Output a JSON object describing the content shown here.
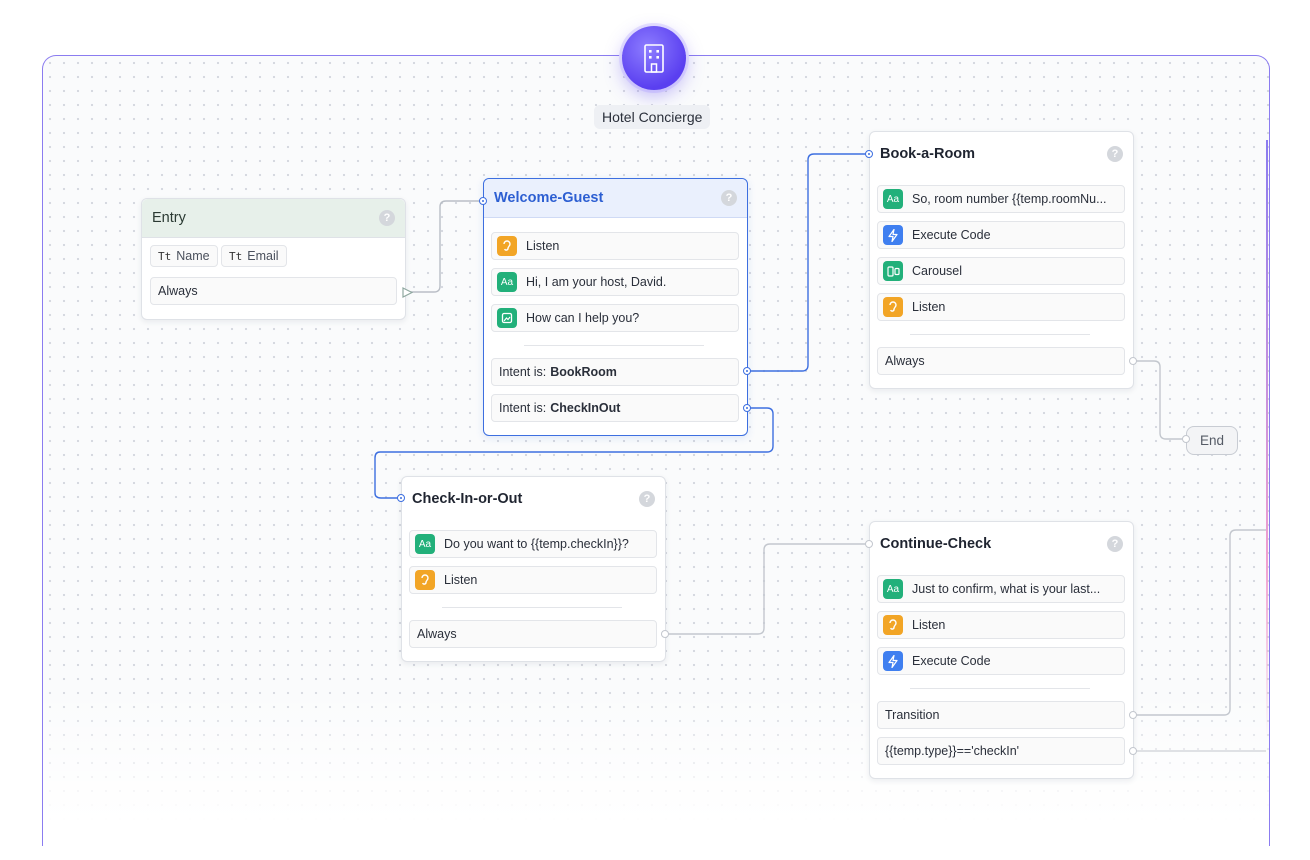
{
  "canvas": {
    "title": "Hotel Concierge",
    "logo_icon": "building-icon",
    "accent": "#5a3ff0"
  },
  "entry": {
    "title": "Entry",
    "variables": [
      "Name",
      "Email"
    ],
    "variable_glyph": "Tt",
    "condition": "Always"
  },
  "welcome": {
    "title": "Welcome-Guest",
    "steps": [
      {
        "type": "Listen",
        "label": "Listen",
        "icon": "ear-icon"
      },
      {
        "type": "Text",
        "label": "Hi, I am your host, David.",
        "icon": "text-icon"
      },
      {
        "type": "Image",
        "label": "How can I help you?",
        "icon": "image-icon"
      }
    ],
    "intent_prefix": "Intent is:",
    "intents": [
      "BookRoom",
      "CheckInOut"
    ]
  },
  "book": {
    "title": "Book-a-Room",
    "steps": [
      {
        "label": "So, room number {{temp.roomNu...",
        "icon": "text-icon"
      },
      {
        "label": "Execute Code",
        "icon": "lightning-icon"
      },
      {
        "label": "Carousel",
        "icon": "carousel-icon"
      },
      {
        "label": "Listen",
        "icon": "ear-icon"
      }
    ],
    "condition": "Always"
  },
  "checkinout": {
    "title": "Check-In-or-Out",
    "steps": [
      {
        "label": "Do you want to {{temp.checkIn}}?",
        "icon": "text-icon"
      },
      {
        "label": "Listen",
        "icon": "ear-icon"
      }
    ],
    "condition": "Always"
  },
  "continue": {
    "title": "Continue-Check",
    "steps": [
      {
        "label": "Just to confirm, what is your last...",
        "icon": "text-icon"
      },
      {
        "label": "Listen",
        "icon": "ear-icon"
      },
      {
        "label": "Execute Code",
        "icon": "lightning-icon"
      }
    ],
    "transitions": [
      "Transition",
      "{{temp.type}}=='checkIn'"
    ]
  },
  "end": {
    "label": "End"
  },
  "help_glyph": "?",
  "icon_glyphs": {
    "text": "Aa"
  }
}
